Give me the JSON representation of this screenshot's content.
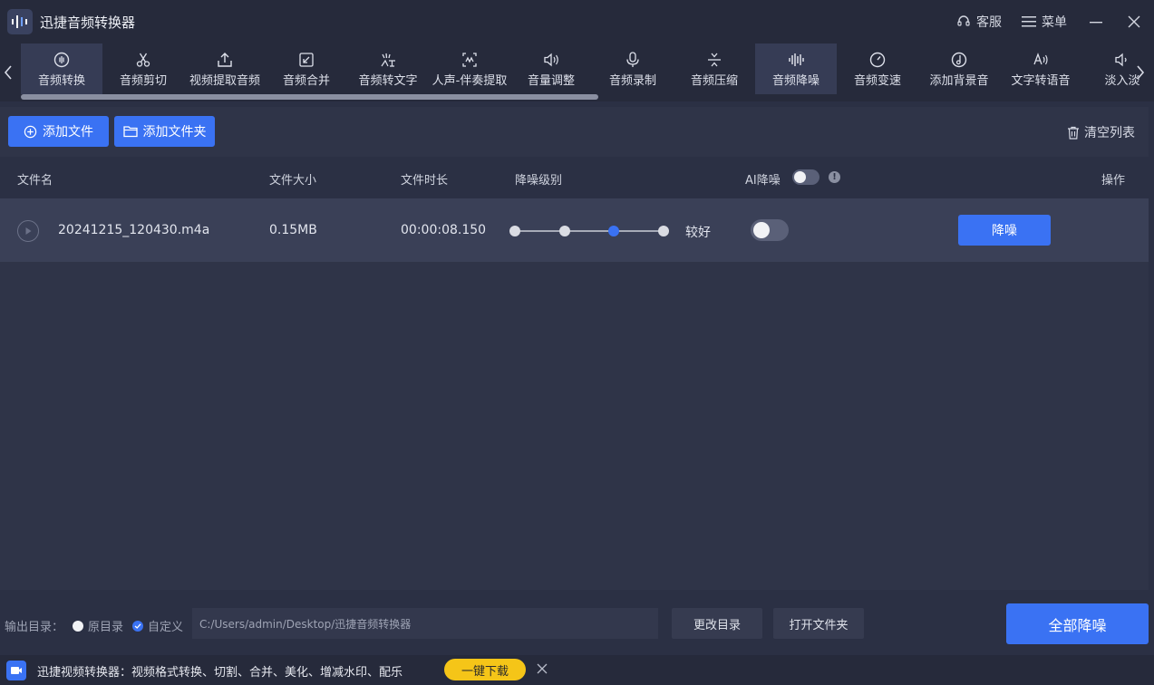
{
  "app": {
    "title": "迅捷音频转换器"
  },
  "titlebar": {
    "service": "客服",
    "menu": "菜单"
  },
  "tools": [
    {
      "label": "音频转换",
      "icon": "audio-convert-icon",
      "active": true
    },
    {
      "label": "音频剪切",
      "icon": "scissors-icon"
    },
    {
      "label": "视频提取音频",
      "icon": "upload-icon"
    },
    {
      "label": "音频合并",
      "icon": "merge-icon"
    },
    {
      "label": "音频转文字",
      "icon": "speech-to-text-icon"
    },
    {
      "label": "人声-伴奏提取",
      "icon": "vocal-extract-icon"
    },
    {
      "label": "音量调整",
      "icon": "volume-icon"
    },
    {
      "label": "音频录制",
      "icon": "microphone-icon"
    },
    {
      "label": "音频压缩",
      "icon": "compress-icon"
    },
    {
      "label": "音频降噪",
      "icon": "waveform-icon",
      "active": true
    },
    {
      "label": "音频变速",
      "icon": "speed-icon"
    },
    {
      "label": "添加背景音",
      "icon": "music-icon"
    },
    {
      "label": "文字转语音",
      "icon": "text-to-speech-icon"
    },
    {
      "label": "淡入淡",
      "icon": "fade-icon"
    }
  ],
  "actions": {
    "add_file": "添加文件",
    "add_folder": "添加文件夹",
    "clear_list": "清空列表"
  },
  "table": {
    "headers": {
      "name": "文件名",
      "size": "文件大小",
      "duration": "文件时长",
      "level": "降噪级别",
      "ai": "AI降噪",
      "ops": "操作"
    },
    "rows": [
      {
        "name": "20241215_120430.m4a",
        "size": "0.15MB",
        "duration": "00:00:08.150",
        "level_label": "较好",
        "level_index": 2,
        "level_steps": 4,
        "ai_denoise": false,
        "action": "降噪"
      }
    ]
  },
  "output": {
    "label": "输出目录：",
    "option_original": "原目录",
    "option_custom": "自定义",
    "selected": "custom",
    "path": "C:/Users/admin/Desktop/迅捷音频转换器",
    "change_dir": "更改目录",
    "open_folder": "打开文件夹",
    "process_all": "全部降噪"
  },
  "promo": {
    "text": "迅捷视频转换器：视频格式转换、切割、合并、美化、增减水印、配乐",
    "button": "一键下载"
  },
  "colors": {
    "accent": "#3a72f3",
    "promo_button": "#f5c518",
    "background": "#2b3044"
  }
}
